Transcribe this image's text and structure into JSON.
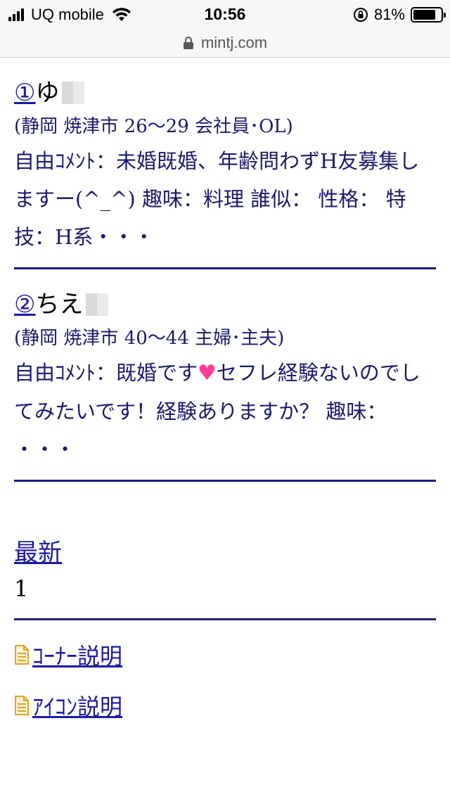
{
  "status_bar": {
    "carrier": "UQ mobile",
    "time": "10:56",
    "battery_percent_label": "81%",
    "battery_level": 0.81
  },
  "url_bar": {
    "domain": "mintj.com"
  },
  "entries": [
    {
      "number": "①",
      "name": "ゆ",
      "location": "(静岡 焼津市 26〜29 会社員･OL)",
      "comment": "自由ｺﾒﾝﾄ：未婚既婚、年齢問わずH友募集しますー(^_^) 趣味：料理 誰似： 性格： 特技：H系・・・"
    },
    {
      "number": "②",
      "name": "ちえ",
      "location": "(静岡 焼津市 40〜44 主婦･主夫)",
      "comment_before": "自由ｺﾒﾝﾄ：既婚です",
      "comment_after": "セフレ経験ないのでしてみたいです！経験ありますか？ 趣味： ・・・"
    }
  ],
  "pagination": {
    "latest_label": "最新",
    "page": "1"
  },
  "footer": {
    "corner_label": "ｺｰﾅｰ説明",
    "icon_label": "ｱｲｺﾝ説明"
  },
  "colors": {
    "link": "#1a1aa6",
    "text": "#1a1a6e",
    "rule": "#1a1a80",
    "heart": "#ff3c9a"
  }
}
